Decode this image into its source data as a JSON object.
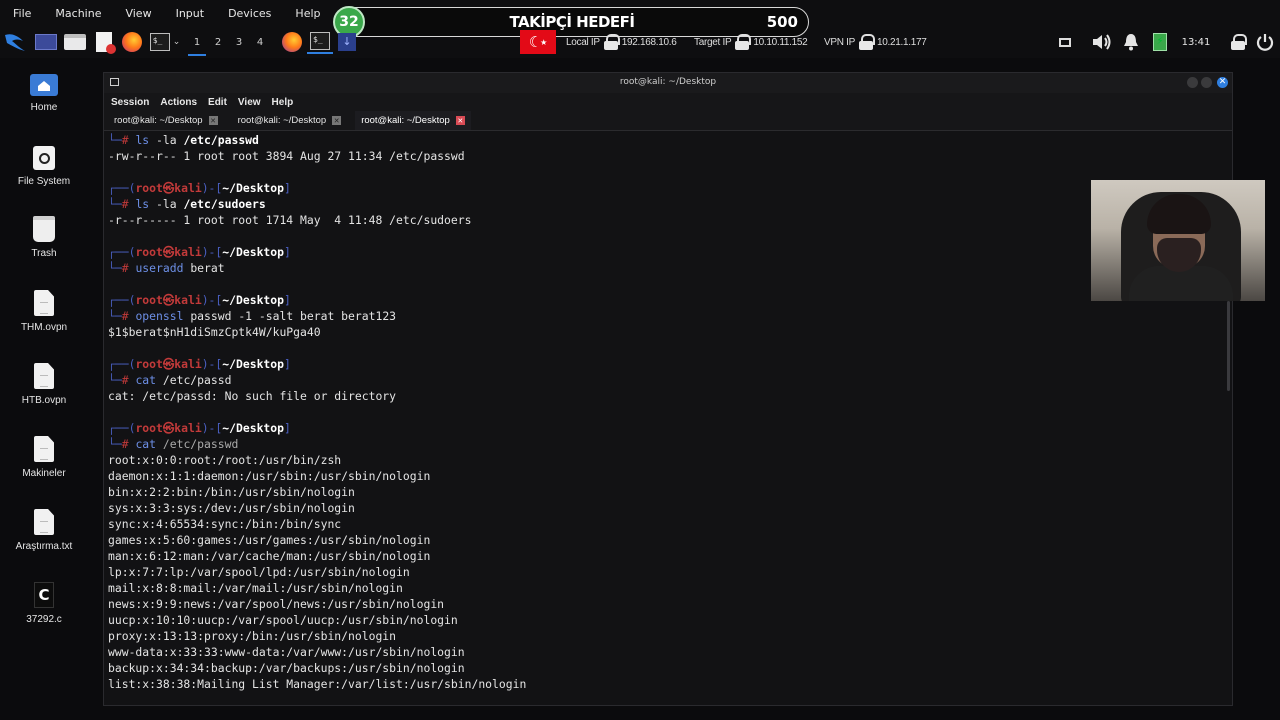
{
  "vbox_menu": [
    "File",
    "Machine",
    "View",
    "Input",
    "Devices",
    "Help"
  ],
  "goal": {
    "count": "32",
    "title": "TAKİPÇİ HEDEFİ",
    "target": "500"
  },
  "panel": {
    "workspaces": [
      "1",
      "2",
      "3",
      "4"
    ],
    "local_ip_label": "Local IP",
    "local_ip": "192.168.10.6",
    "target_ip_label": "Target IP",
    "target_ip": "10.10.11.152",
    "vpn_ip_label": "VPN IP",
    "vpn_ip": "10.21.1.177",
    "clock": "13:41"
  },
  "desktop_icons": [
    {
      "label": "Home",
      "icon": "home-folder-icon"
    },
    {
      "label": "File System",
      "icon": "drive-icon"
    },
    {
      "label": "Trash",
      "icon": "trash-icon"
    },
    {
      "label": "THM.ovpn",
      "icon": "file-icon"
    },
    {
      "label": "HTB.ovpn",
      "icon": "file-icon"
    },
    {
      "label": "Makineler",
      "icon": "file-icon"
    },
    {
      "label": "Araştırma.txt",
      "icon": "file-icon"
    },
    {
      "label": "37292.c",
      "icon": "c-source-icon"
    }
  ],
  "terminal": {
    "title": "root@kali: ~/Desktop",
    "menu": [
      "Session",
      "Actions",
      "Edit",
      "View",
      "Help"
    ],
    "tabs": [
      {
        "label": "root@kali: ~/Desktop",
        "active": false
      },
      {
        "label": "root@kali: ~/Desktop",
        "active": false
      },
      {
        "label": "root@kali: ~/Desktop",
        "active": true
      }
    ],
    "prompt": {
      "user": "root㉿kali",
      "dir": "~/Desktop"
    },
    "lines": {
      "l01_arg": "/etc/passwd",
      "l02": "-rw-r--r-- 1 root root 3894 Aug 27 11:34 /etc/passwd",
      "l05_arg": "/etc/sudoers",
      "l06": "-r--r----- 1 root root 1714 May  4 11:48 /etc/sudoers",
      "l09_args": "berat",
      "l12_cmd": "openssl",
      "l12_args": "passwd -1 -salt berat berat123",
      "l13": "$1$berat$nH1diSmzCptk4W/kuPga40",
      "l16_args": "/etc/passd",
      "l17": "cat: /etc/passd: No such file or directory",
      "l20_args": "/etc/passwd",
      "passwd": [
        "root:x:0:0:root:/root:/usr/bin/zsh",
        "daemon:x:1:1:daemon:/usr/sbin:/usr/sbin/nologin",
        "bin:x:2:2:bin:/bin:/usr/sbin/nologin",
        "sys:x:3:3:sys:/dev:/usr/sbin/nologin",
        "sync:x:4:65534:sync:/bin:/bin/sync",
        "games:x:5:60:games:/usr/games:/usr/sbin/nologin",
        "man:x:6:12:man:/var/cache/man:/usr/sbin/nologin",
        "lp:x:7:7:lp:/var/spool/lpd:/usr/sbin/nologin",
        "mail:x:8:8:mail:/var/mail:/usr/sbin/nologin",
        "news:x:9:9:news:/var/spool/news:/usr/sbin/nologin",
        "uucp:x:10:10:uucp:/var/spool/uucp:/usr/sbin/nologin",
        "proxy:x:13:13:proxy:/bin:/usr/sbin/nologin",
        "www-data:x:33:33:www-data:/var/www:/usr/sbin/nologin",
        "backup:x:34:34:backup:/var/backups:/usr/sbin/nologin",
        "list:x:38:38:Mailing List Manager:/var/list:/usr/sbin/nologin"
      ]
    }
  },
  "colors": {
    "accent_blue": "#4a5fc1",
    "prompt_red": "#c23a3a",
    "command_blue": "#6d8fe6",
    "goal_green": "#3aa84a",
    "close_red": "#d94b55"
  }
}
